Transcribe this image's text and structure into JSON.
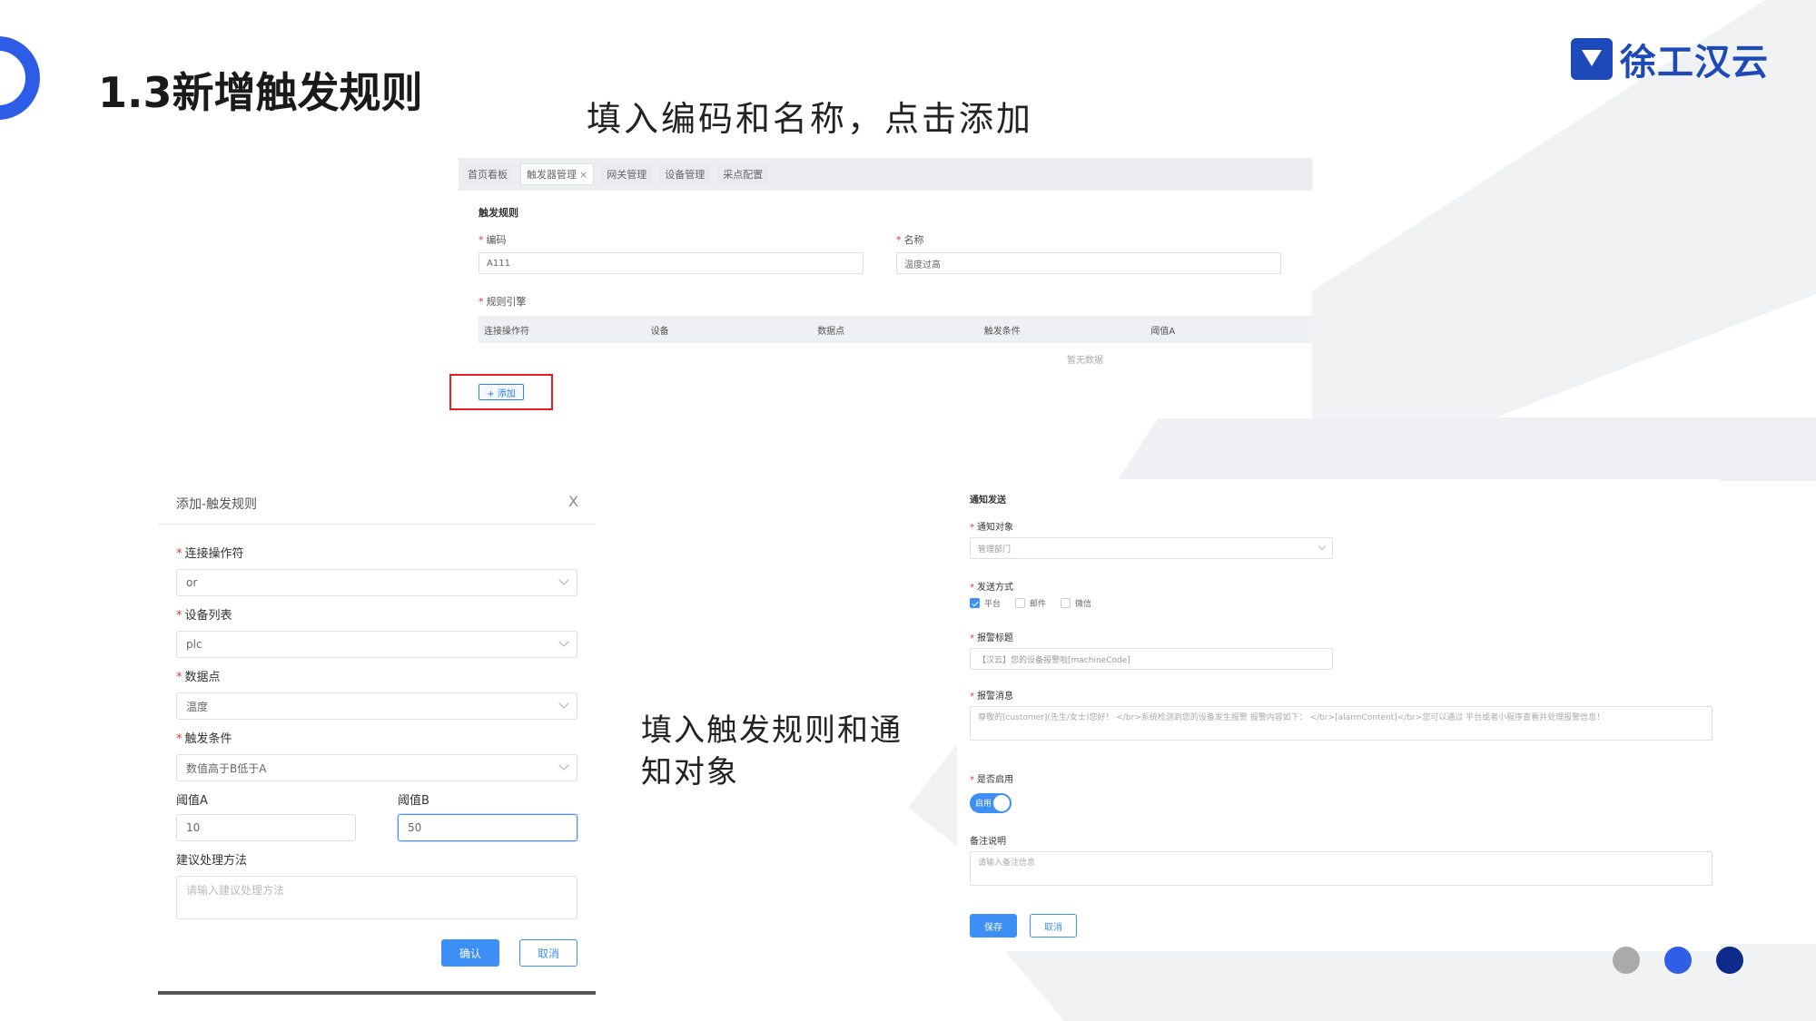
{
  "slide": {
    "title": "1.3新增触发规则",
    "brand": "徐工汉云",
    "caption_top": "填入编码和名称，点击添加",
    "caption_bottom": "填入触发规则和通知对象",
    "colors": {
      "accent": "#2d5ce6",
      "brand": "#1e49b8",
      "highlight_box": "#e02020",
      "dot_gray": "#aaaaaa",
      "dot_blue": "#2f5fe6",
      "dot_navy": "#0e2a8a"
    }
  },
  "panel1": {
    "tabs": [
      {
        "label": "首页看板",
        "closable": false,
        "active": false
      },
      {
        "label": "触发器管理",
        "closable": true,
        "active": true
      },
      {
        "label": "网关管理",
        "closable": false,
        "active": false
      },
      {
        "label": "设备管理",
        "closable": false,
        "active": false
      },
      {
        "label": "采点配置",
        "closable": false,
        "active": false
      }
    ],
    "close_glyph": "×",
    "section_title": "触发规则",
    "code_label": "编码",
    "code_value": "A111",
    "name_label": "名称",
    "name_value": "温度过高",
    "rules_label": "规则引擎",
    "table_headers": [
      "连接操作符",
      "设备",
      "数据点",
      "触发条件",
      "阈值A"
    ],
    "empty_text": "暂无数据",
    "add_button": "+ 添加"
  },
  "dialog": {
    "title": "添加-触发规则",
    "close_glyph": "X",
    "operator_label": "连接操作符",
    "operator_value": "or",
    "device_label": "设备列表",
    "device_value": "plc",
    "point_label": "数据点",
    "point_value": "温度",
    "condition_label": "触发条件",
    "condition_value": "数值高于B低于A",
    "threshold_a_label": "阈值A",
    "threshold_a_value": "10",
    "threshold_b_label": "阈值B",
    "threshold_b_value": "50",
    "suggestion_label": "建议处理方法",
    "suggestion_placeholder": "请输入建议处理方法",
    "confirm_button": "确认",
    "cancel_button": "取消"
  },
  "notify": {
    "section_title": "通知发送",
    "target_label": "通知对象",
    "target_value": "管理部门",
    "method_label": "发送方式",
    "methods": [
      {
        "label": "平台",
        "checked": true
      },
      {
        "label": "邮件",
        "checked": false
      },
      {
        "label": "微信",
        "checked": false
      }
    ],
    "alarm_title_label": "报警标题",
    "alarm_title_value": "【汉云】您的设备报警啦[machineCode]",
    "alarm_message_label": "报警消息",
    "alarm_message_value": "尊敬的[customer](先生/女士)您好！ </br>系统检测到您的设备发生报警 报警内容如下： </br>[alarmContent]</br>您可以通过 平台或者小程序查看并处理报警信息！",
    "enable_label": "是否启用",
    "enable_switch_text": "启用",
    "enabled": true,
    "remark_label": "备注说明",
    "remark_placeholder": "请输入备注信息",
    "save_button": "保存",
    "cancel_button": "取消"
  },
  "required_mark": "*"
}
